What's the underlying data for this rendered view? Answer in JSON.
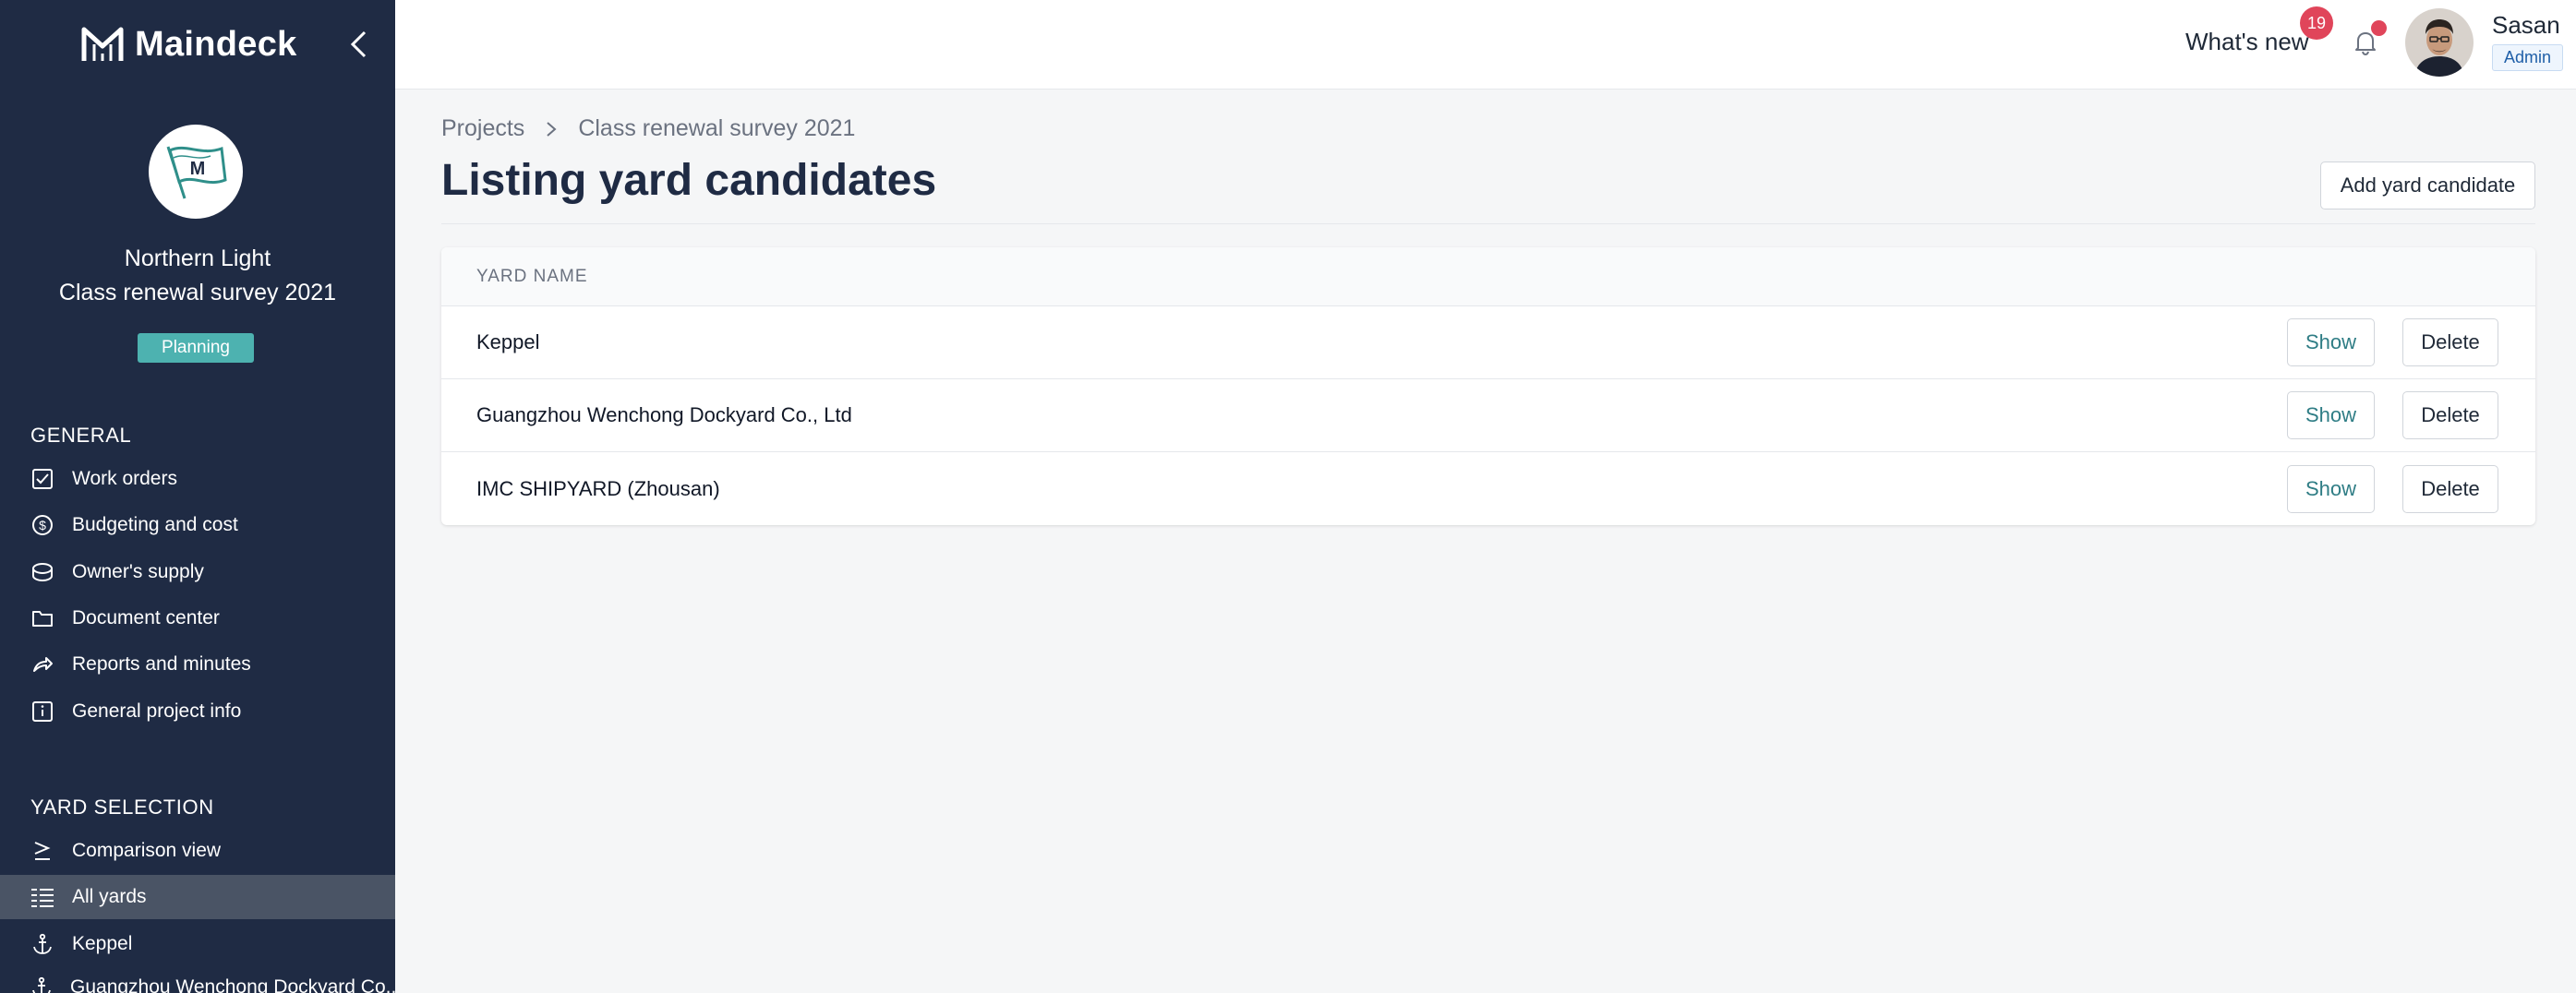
{
  "brand": {
    "name": "Maindeck"
  },
  "vessel": {
    "logo_letter": "M",
    "name": "Northern Light",
    "project": "Class renewal survey 2021",
    "status": "Planning",
    "status_color": "#4db2b0"
  },
  "sidebar": {
    "general_label": "GENERAL",
    "general_items": [
      {
        "label": "Work orders",
        "icon": "checkbox-icon"
      },
      {
        "label": "Budgeting and cost",
        "icon": "dollar-icon"
      },
      {
        "label": "Owner's supply",
        "icon": "box-icon"
      },
      {
        "label": "Document center",
        "icon": "folder-icon"
      },
      {
        "label": "Reports and minutes",
        "icon": "share-icon"
      },
      {
        "label": "General project info",
        "icon": "info-icon"
      }
    ],
    "yard_label": "YARD SELECTION",
    "yard_items": [
      {
        "label": "Comparison view",
        "icon": "compare-icon",
        "active": false
      },
      {
        "label": "All yards",
        "icon": "list-icon",
        "active": true
      },
      {
        "label": "Keppel",
        "icon": "anchor-icon",
        "active": false
      },
      {
        "label": "Guangzhou Wenchong Dockyard Co., Ltd",
        "icon": "anchor-icon",
        "active": false
      }
    ]
  },
  "header": {
    "whats_new": "What's new",
    "whats_new_count": "19",
    "user_name": "Sasan",
    "user_role": "Admin"
  },
  "breadcrumb": {
    "root": "Projects",
    "current": "Class renewal survey 2021"
  },
  "page": {
    "title": "Listing yard candidates",
    "add_button": "Add yard candidate"
  },
  "table": {
    "header": "YARD NAME",
    "show_label": "Show",
    "delete_label": "Delete",
    "rows": [
      {
        "name": "Keppel"
      },
      {
        "name": "Guangzhou Wenchong Dockyard Co., Ltd"
      },
      {
        "name": "IMC SHIPYARD (Zhousan)"
      }
    ]
  },
  "colors": {
    "sidebar_bg": "#1f2b44",
    "accent_teal": "#2f7d85",
    "badge_red": "#e0455a"
  }
}
